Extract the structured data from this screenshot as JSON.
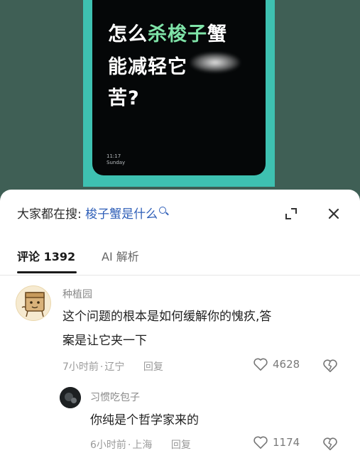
{
  "hero": {
    "line1_prefix": "怎么",
    "line1_accent": "杀梭子",
    "line1_suffix": "蟹",
    "line2": "能减轻它",
    "line3": "苦?",
    "time": "11:17",
    "day": "Sunday",
    "accent_color": "#7fe3a8",
    "frame_color": "#3ec1b1"
  },
  "search": {
    "prefix": "大家都在搜:",
    "term": "梭子蟹是什么",
    "term_color": "#2f5fb8"
  },
  "tabs": [
    {
      "label": "评论 1392"
    },
    {
      "label": "AI 解析"
    }
  ],
  "comments": [
    {
      "user": "种植园",
      "text_line1": "这个问题的根本是如何缓解你的愧疚,答",
      "text_line2": "案是让它夹一下",
      "time": "7小时前",
      "location": "辽宁",
      "reply_label": "回复",
      "likes": "4628",
      "avatar": "cartoon-box-avatar"
    },
    {
      "user": "习惯吃包子",
      "text_line1": "你纯是个哲学家来的",
      "time": "6小时前",
      "location": "上海",
      "reply_label": "回复",
      "likes": "1174",
      "avatar": "dark-photo-avatar"
    }
  ]
}
